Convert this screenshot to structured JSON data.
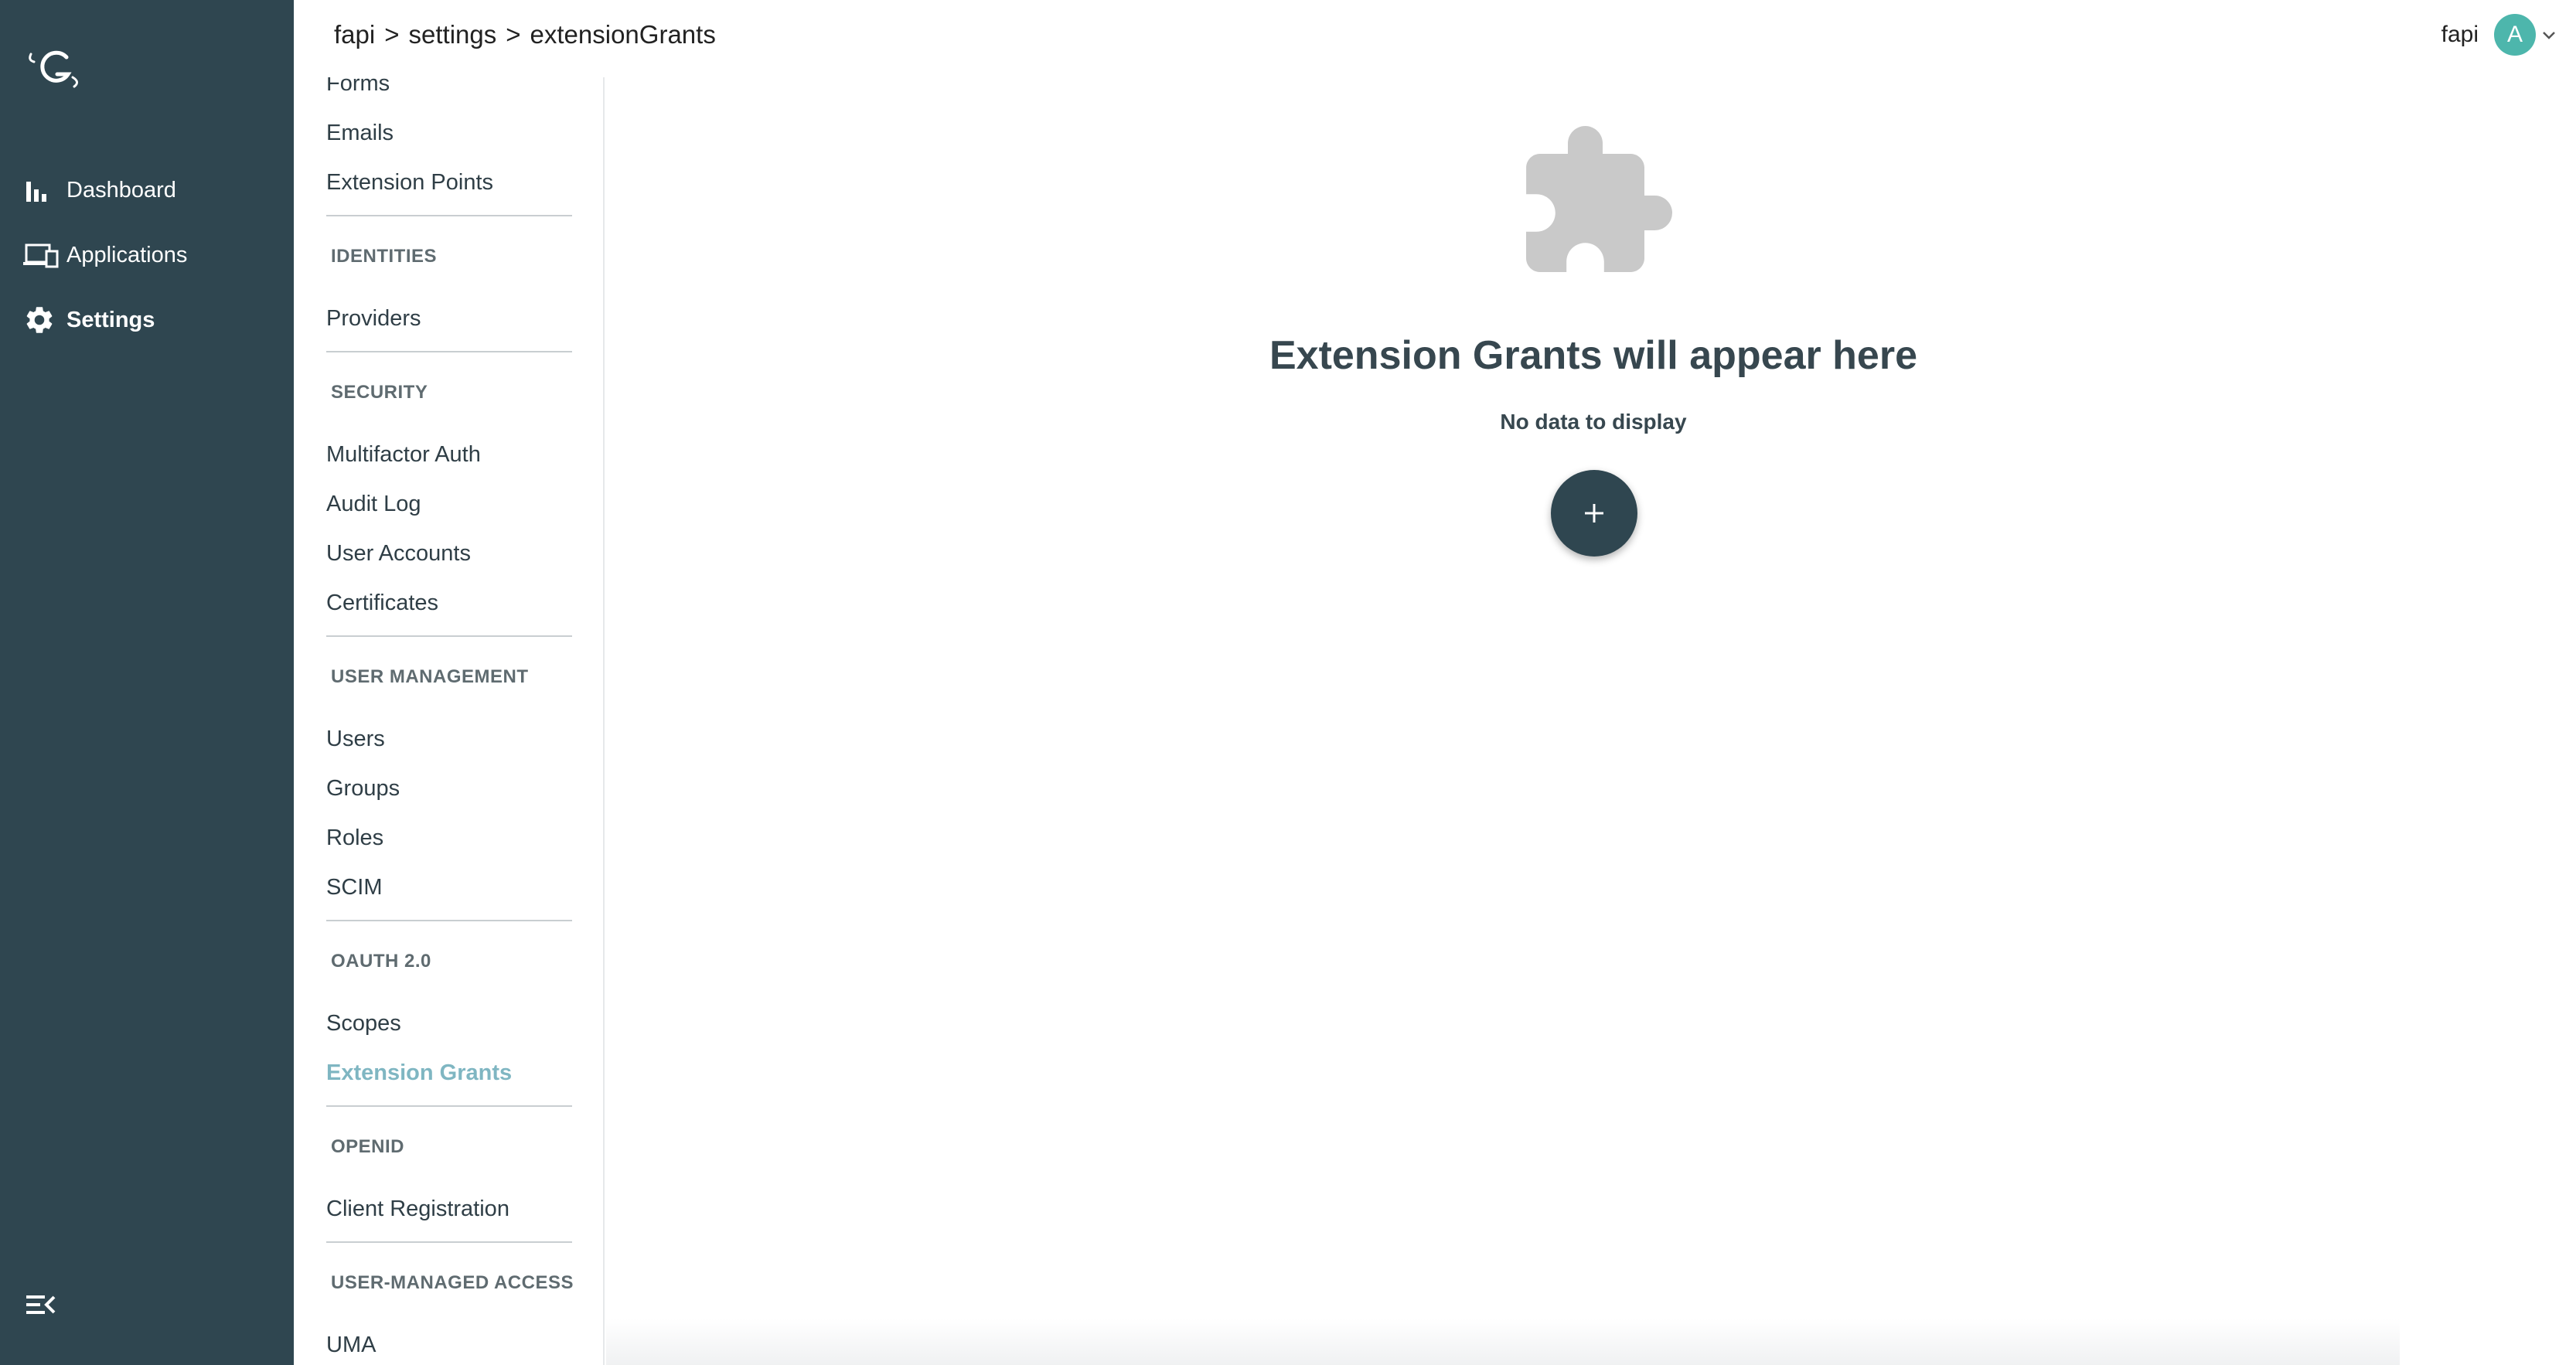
{
  "breadcrumb": {
    "items": [
      "fapi",
      "settings",
      "extensionGrants"
    ],
    "separator": ">"
  },
  "user": {
    "name": "fapi",
    "avatar_letter": "A",
    "avatar_color": "#4db6ac"
  },
  "nav": {
    "items": [
      {
        "label": "Dashboard",
        "icon": "bar-chart-icon"
      },
      {
        "label": "Applications",
        "icon": "devices-icon"
      },
      {
        "label": "Settings",
        "icon": "gear-icon",
        "active": true
      }
    ],
    "background": "#2f4650"
  },
  "submenu": {
    "links_top": [
      "Forms",
      "Emails",
      "Extension Points"
    ],
    "identities": {
      "heading": "IDENTITIES",
      "items": [
        "Providers"
      ]
    },
    "security": {
      "heading": "SECURITY",
      "items": [
        "Multifactor Auth",
        "Audit Log",
        "User Accounts",
        "Certificates"
      ]
    },
    "user_management": {
      "heading": "USER MANAGEMENT",
      "items": [
        "Users",
        "Groups",
        "Roles",
        "SCIM"
      ]
    },
    "oauth": {
      "heading": "OAUTH 2.0",
      "items": [
        "Scopes",
        "Extension Grants"
      ],
      "active": "Extension Grants"
    },
    "openid": {
      "heading": "OPENID",
      "items": [
        "Client Registration"
      ]
    },
    "uma": {
      "heading": "USER-MANAGED ACCESS",
      "items": [
        "UMA"
      ]
    },
    "active_color": "#7fb6c2"
  },
  "empty_state": {
    "icon": "puzzle-piece-icon",
    "title": "Extension Grants will appear here",
    "subtitle": "No data to display",
    "add_icon": "plus-icon"
  }
}
